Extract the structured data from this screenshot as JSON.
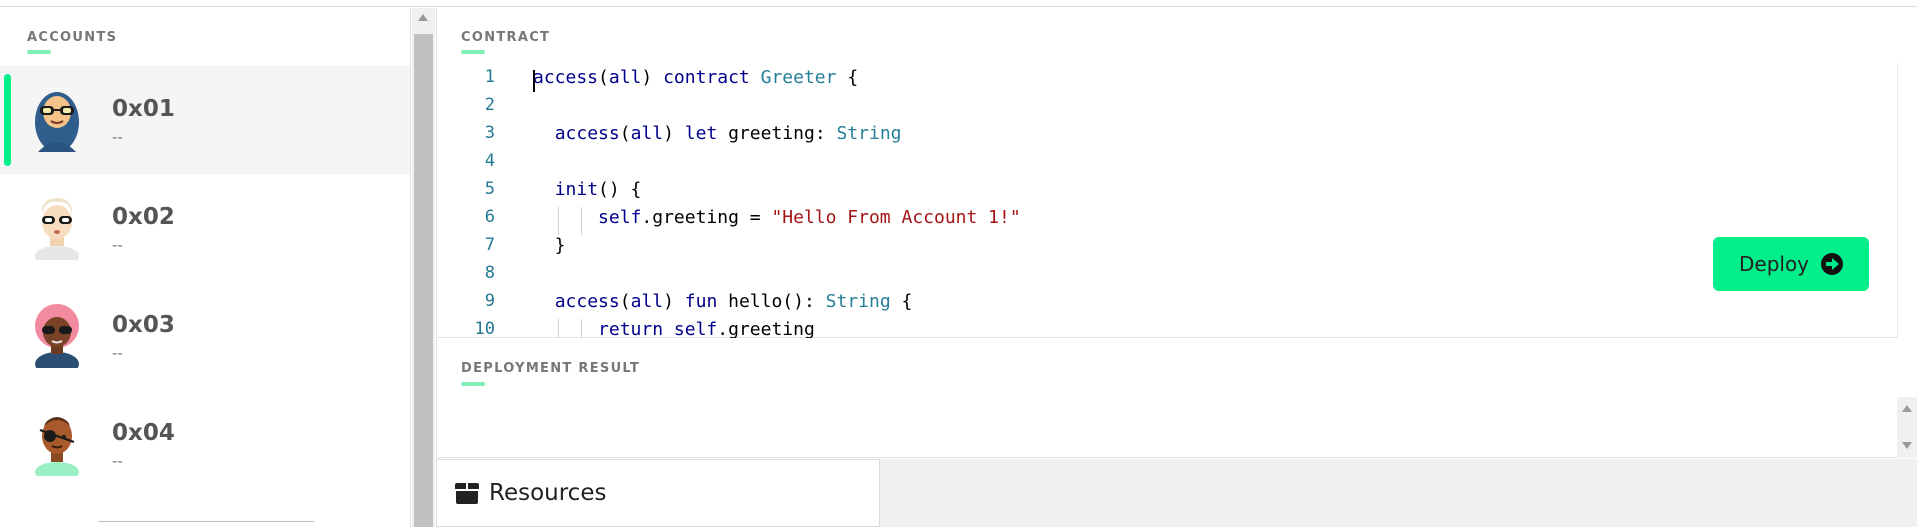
{
  "accounts_panel": {
    "title": "ACCOUNTS",
    "items": [
      {
        "address": "0x01",
        "subtitle": "--",
        "selected": true,
        "avatar": "hijab-sunglasses-avatar"
      },
      {
        "address": "0x02",
        "subtitle": "--",
        "selected": false,
        "avatar": "blonde-sunglasses-avatar"
      },
      {
        "address": "0x03",
        "subtitle": "--",
        "selected": false,
        "avatar": "pink-hair-sunglasses-avatar"
      },
      {
        "address": "0x04",
        "subtitle": "--",
        "selected": false,
        "avatar": "eyepatch-avatar"
      }
    ]
  },
  "contract_panel": {
    "title": "CONTRACT",
    "line_numbers": [
      "1",
      "2",
      "3",
      "4",
      "5",
      "6",
      "7",
      "8",
      "9",
      "10"
    ],
    "deploy_label": "Deploy"
  },
  "result_panel": {
    "title": "DEPLOYMENT RESULT"
  },
  "bottom_bar": {
    "resources_label": "Resources"
  },
  "colors": {
    "accent": "#00ef8b",
    "accent_light": "#7ff0b4",
    "keyword": "#0000ff",
    "type": "#267f99",
    "string": "#a31515",
    "line_number": "#237893"
  }
}
